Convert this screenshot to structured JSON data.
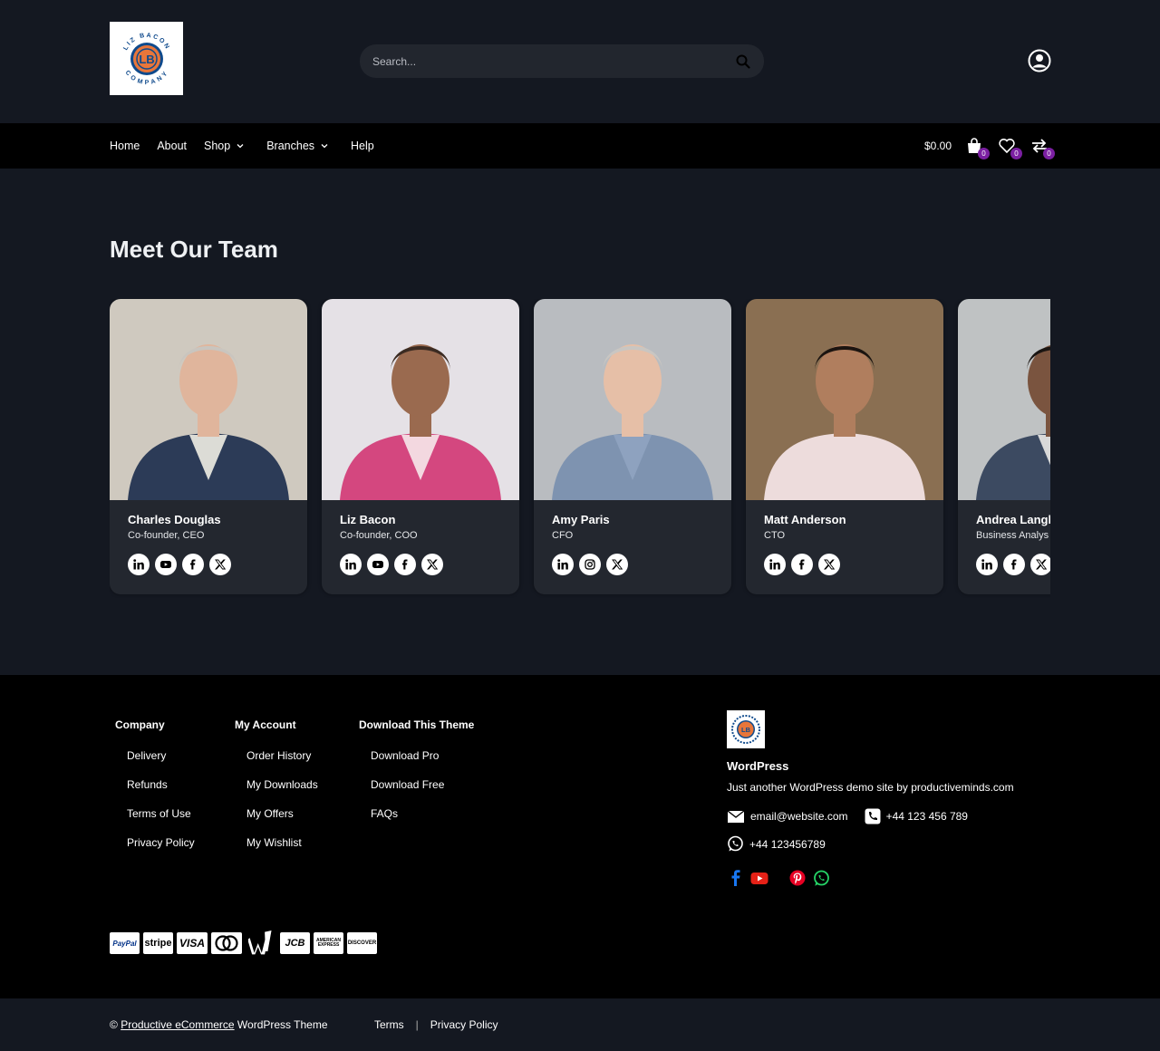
{
  "header": {
    "logo_top": "LIZ BACON",
    "logo_bottom": "COMPANY",
    "logo_initials": "LB",
    "search_placeholder": "Search..."
  },
  "nav": {
    "items": [
      {
        "label": "Home"
      },
      {
        "label": "About"
      },
      {
        "label": "Shop",
        "dropdown": true
      },
      {
        "label": "Branches",
        "dropdown": true
      },
      {
        "label": "Help"
      }
    ],
    "cart_total": "$0.00",
    "cart_count": "0",
    "wishlist_count": "0",
    "compare_count": "0"
  },
  "team": {
    "title": "Meet Our Team",
    "members": [
      {
        "name": "Charles Douglas",
        "role": "Co-founder, CEO",
        "socials": [
          "linkedin-icon",
          "youtube-icon",
          "facebook-icon",
          "x-icon"
        ],
        "bg": "#cfc9bf",
        "suit": "#2c3b57",
        "shirt": "#dcdcd6",
        "skin": "#e0b59c",
        "hair": "#c9c5bf"
      },
      {
        "name": "Liz Bacon",
        "role": "Co-founder, COO",
        "socials": [
          "linkedin-icon",
          "youtube-icon",
          "facebook-icon",
          "x-icon"
        ],
        "bg": "#e5e1e6",
        "suit": "#d4477f",
        "shirt": "#f3d8e0",
        "skin": "#9a6a4f",
        "hair": "#3b2b22"
      },
      {
        "name": "Amy Paris",
        "role": "CFO",
        "socials": [
          "linkedin-icon",
          "instagram-icon",
          "x-icon"
        ],
        "bg": "#b9bcc0",
        "suit": "#7e93b0",
        "shirt": "#8ea2bf",
        "skin": "#e6bfa7",
        "hair": "#c9c6c2"
      },
      {
        "name": "Matt Anderson",
        "role": "CTO",
        "socials": [
          "linkedin-icon",
          "facebook-icon",
          "x-icon"
        ],
        "bg": "#8a6f52",
        "suit": "#eddcdc",
        "shirt": "#eddcdc",
        "skin": "#b07e5e",
        "hair": "#1b1410"
      },
      {
        "name": "Andrea Langle",
        "role": "Business Analys",
        "socials": [
          "linkedin-icon",
          "facebook-icon",
          "x-icon"
        ],
        "bg": "#bfc2c3",
        "suit": "#3c4a61",
        "shirt": "#d9d9d9",
        "skin": "#7a543f",
        "hair": "#1a1512"
      }
    ]
  },
  "footer": {
    "columns": [
      {
        "title": "Company",
        "links": [
          "Delivery",
          "Refunds",
          "Terms of Use",
          "Privacy Policy"
        ]
      },
      {
        "title": "My Account",
        "links": [
          "Order History",
          "My Downloads",
          "My Offers",
          "My Wishlist"
        ]
      },
      {
        "title": "Download This Theme",
        "links": [
          "Download Pro",
          "Download Free",
          "FAQs"
        ]
      }
    ],
    "brand_name": "WordPress",
    "brand_tagline": "Just another WordPress demo site by productiveminds.com",
    "email": "email@website.com",
    "phone": "+44 123 456 789",
    "whatsapp": "+44 123456789",
    "payments": [
      "PayPal",
      "stripe",
      "VISA",
      "mastercard",
      "W",
      "JCB",
      "AMERICAN EXPRESS",
      "DISCOVER"
    ]
  },
  "bottom": {
    "copy_prefix": "© ",
    "copy_link": "Productive eCommerce",
    "copy_suffix": " WordPress Theme",
    "terms": "Terms",
    "sep": "|",
    "privacy": "Privacy Policy"
  },
  "colors": {
    "accent_badge": "#7b1fa2",
    "logo_orange": "#e8763a",
    "logo_blue": "#0f4a8c"
  }
}
